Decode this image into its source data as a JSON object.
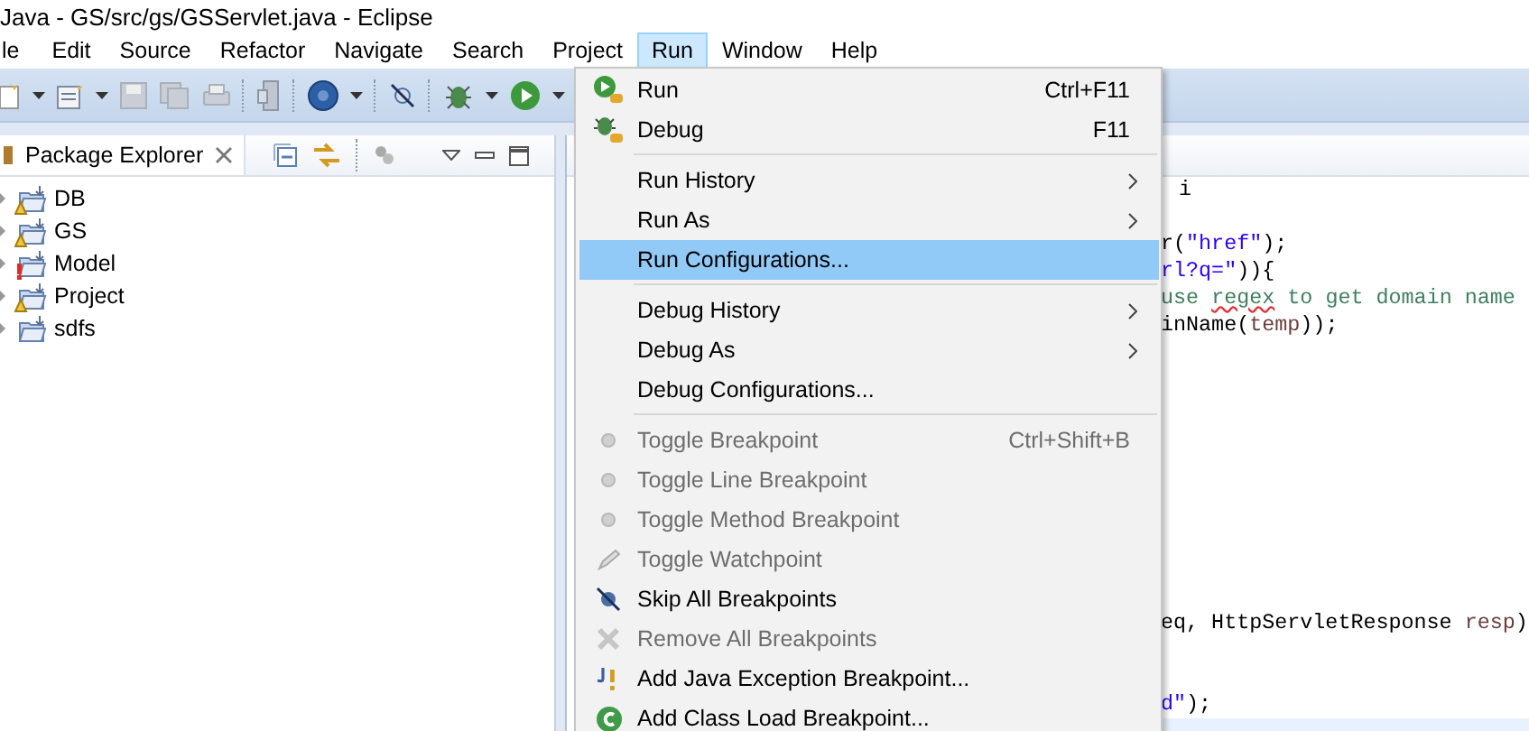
{
  "window": {
    "title": "Java - GS/src/gs/GSServlet.java - Eclipse"
  },
  "menu_bar": [
    {
      "label": "le",
      "selected": false
    },
    {
      "label": "Edit",
      "selected": false
    },
    {
      "label": "Source",
      "selected": false
    },
    {
      "label": "Refactor",
      "selected": false
    },
    {
      "label": "Navigate",
      "selected": false
    },
    {
      "label": "Search",
      "selected": false
    },
    {
      "label": "Project",
      "selected": false
    },
    {
      "label": "Run",
      "selected": true
    },
    {
      "label": "Window",
      "selected": false
    },
    {
      "label": "Help",
      "selected": false
    }
  ],
  "package_explorer": {
    "title": "Package Explorer",
    "projects": [
      {
        "name": "DB",
        "warning": true,
        "error": false,
        "expanded": false
      },
      {
        "name": "GS",
        "warning": true,
        "error": false,
        "expanded": false
      },
      {
        "name": "Model",
        "warning": false,
        "error": true,
        "expanded": false
      },
      {
        "name": "Project",
        "warning": true,
        "error": false,
        "expanded": false
      },
      {
        "name": "sdfs",
        "warning": false,
        "error": false,
        "expanded": false
      }
    ]
  },
  "editor": {
    "lines": [
      {
        "segments": [
          {
            "text": "i",
            "kind": "plain"
          }
        ]
      },
      {
        "segments": [
          {
            "text": "r(",
            "kind": "plain"
          },
          {
            "text": "\"href\"",
            "kind": "string"
          },
          {
            "text": ");",
            "kind": "plain"
          }
        ]
      },
      {
        "segments": [
          {
            "text": "rl?q=\"",
            "kind": "string"
          },
          {
            "text": ")){",
            "kind": "plain"
          }
        ]
      },
      {
        "segments": [
          {
            "text": "use ",
            "kind": "comment"
          },
          {
            "text": "regex",
            "kind": "misspelled_comment"
          },
          {
            "text": " to get domain name",
            "kind": "comment"
          }
        ]
      },
      {
        "segments": [
          {
            "text": "inName(",
            "kind": "plain"
          },
          {
            "text": "temp",
            "kind": "variable"
          },
          {
            "text": "));",
            "kind": "plain"
          }
        ]
      },
      {
        "segments": [
          {
            "text": "eq, HttpServletResponse ",
            "kind": "plain"
          },
          {
            "text": "resp",
            "kind": "variable"
          },
          {
            "text": ")",
            "kind": "plain"
          }
        ]
      },
      {
        "segments": [
          {
            "text": "d\"",
            "kind": "string"
          },
          {
            "text": ");",
            "kind": "plain"
          }
        ]
      }
    ]
  },
  "run_menu": {
    "items": [
      {
        "kind": "item",
        "label": "Run",
        "shortcut": "Ctrl+F11",
        "submenu": false,
        "disabled": false,
        "selected": false
      },
      {
        "kind": "item",
        "label": "Debug",
        "shortcut": "F11",
        "submenu": false,
        "disabled": false,
        "selected": false
      },
      {
        "kind": "separator"
      },
      {
        "kind": "item",
        "label": "Run History",
        "submenu": true,
        "disabled": false,
        "selected": false
      },
      {
        "kind": "item",
        "label": "Run As",
        "submenu": true,
        "disabled": false,
        "selected": false
      },
      {
        "kind": "item",
        "label": "Run Configurations...",
        "submenu": false,
        "disabled": false,
        "selected": true
      },
      {
        "kind": "separator"
      },
      {
        "kind": "item",
        "label": "Debug History",
        "submenu": true,
        "disabled": false,
        "selected": false
      },
      {
        "kind": "item",
        "label": "Debug As",
        "submenu": true,
        "disabled": false,
        "selected": false
      },
      {
        "kind": "item",
        "label": "Debug Configurations...",
        "submenu": false,
        "disabled": false,
        "selected": false
      },
      {
        "kind": "separator"
      },
      {
        "kind": "item",
        "label": "Toggle Breakpoint",
        "shortcut": "Ctrl+Shift+B",
        "submenu": false,
        "disabled": true,
        "selected": false
      },
      {
        "kind": "item",
        "label": "Toggle Line Breakpoint",
        "submenu": false,
        "disabled": true,
        "selected": false
      },
      {
        "kind": "item",
        "label": "Toggle Method Breakpoint",
        "submenu": false,
        "disabled": true,
        "selected": false
      },
      {
        "kind": "item",
        "label": "Toggle Watchpoint",
        "submenu": false,
        "disabled": true,
        "selected": false
      },
      {
        "kind": "item",
        "label": "Skip All Breakpoints",
        "submenu": false,
        "disabled": false,
        "selected": false
      },
      {
        "kind": "item",
        "label": "Remove All Breakpoints",
        "submenu": false,
        "disabled": true,
        "selected": false
      },
      {
        "kind": "item",
        "label": "Add Java Exception Breakpoint...",
        "submenu": false,
        "disabled": false,
        "selected": false
      },
      {
        "kind": "item",
        "label": "Add Class Load Breakpoint...",
        "submenu": false,
        "disabled": false,
        "selected": false
      }
    ]
  }
}
